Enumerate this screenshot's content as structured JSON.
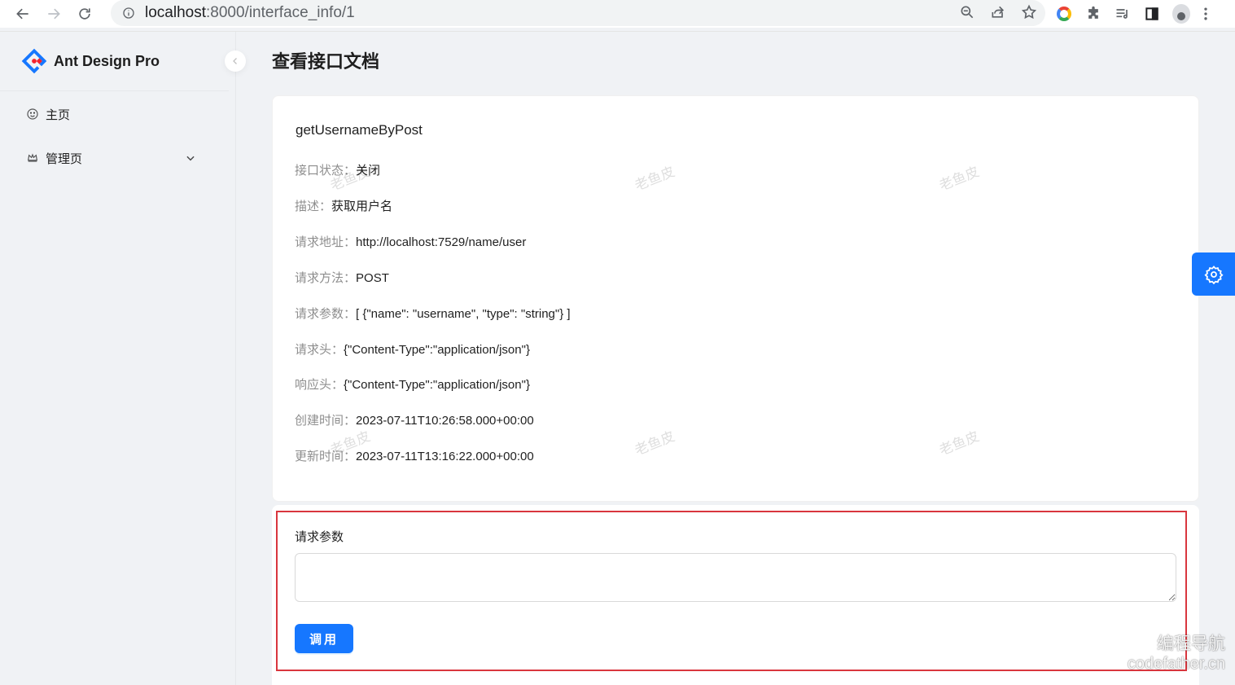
{
  "browser": {
    "url_host": "localhost",
    "url_rest": ":8000/interface_info/1"
  },
  "sidebar": {
    "app_title": "Ant Design Pro",
    "items": [
      {
        "label": "主页",
        "icon": "smile-icon"
      },
      {
        "label": "管理页",
        "icon": "crown-icon"
      }
    ]
  },
  "page": {
    "title": "查看接口文档"
  },
  "interface": {
    "name": "getUsernameByPost",
    "fields": [
      {
        "label": "接口状态：",
        "value": "关闭"
      },
      {
        "label": "描述：",
        "value": "获取用户名"
      },
      {
        "label": "请求地址：",
        "value": "http://localhost:7529/name/user"
      },
      {
        "label": "请求方法：",
        "value": "POST"
      },
      {
        "label": "请求参数：",
        "value": "[ {\"name\": \"username\", \"type\": \"string\"} ]"
      },
      {
        "label": "请求头：",
        "value": "{\"Content-Type\":\"application/json\"}"
      },
      {
        "label": "响应头：",
        "value": "{\"Content-Type\":\"application/json\"}"
      },
      {
        "label": "创建时间：",
        "value": "2023-07-11T10:26:58.000+00:00"
      },
      {
        "label": "更新时间：",
        "value": "2023-07-11T13:16:22.000+00:00"
      }
    ]
  },
  "invoke_form": {
    "label": "请求参数",
    "textarea_value": "",
    "button_label": "调用"
  },
  "watermark": {
    "text": "老鱼皮"
  },
  "corner_watermark": {
    "line1": "编程导航",
    "line2": "codefather.cn"
  },
  "colors": {
    "primary": "#1677ff",
    "highlight_border": "#d9363e"
  }
}
